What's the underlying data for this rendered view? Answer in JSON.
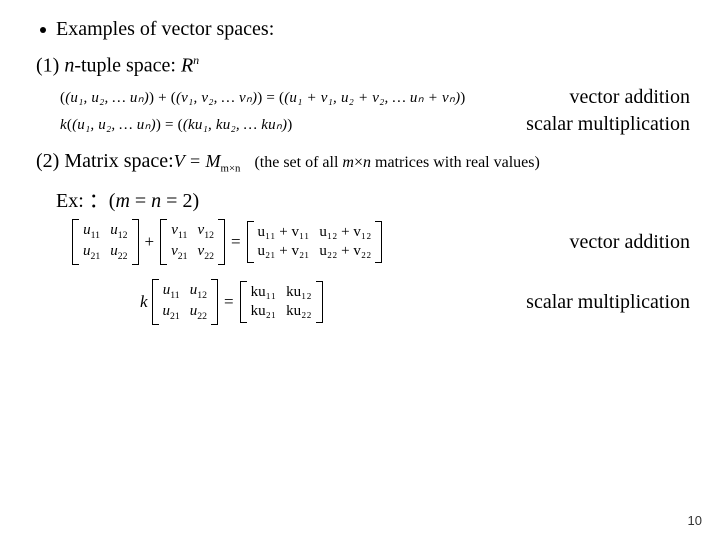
{
  "header": {
    "bullet_title": "Examples of vector spaces:"
  },
  "sec1": {
    "label_prefix": "(1) ",
    "label_n": "n",
    "label_suffix": "-tuple space:  ",
    "space_R": "R",
    "space_exp": "n",
    "eq_add_lhs1": "(u₁, u₂, … uₙ)",
    "eq_add_plus": " + ",
    "eq_add_lhs2": "(v₁, v₂, … vₙ)",
    "eq_add_eq": " = ",
    "eq_add_rhs": "(u₁ + v₁, u₂ + v₂, … uₙ + vₙ)",
    "eq_add_label": "vector addition",
    "eq_sm_k": "k",
    "eq_sm_lhs": "(u₁, u₂, … uₙ)",
    "eq_sm_eq": " = ",
    "eq_sm_rhs": "(ku₁, ku₂, … kuₙ)",
    "eq_sm_label": "scalar multiplication"
  },
  "sec2": {
    "label": "(2) Matrix space:  ",
    "V_eq": "V = M",
    "V_sub": "m×n",
    "note_open": "(the set of all ",
    "note_m": "m",
    "note_x": "×",
    "note_n": "n",
    "note_close": " matrices with real values)",
    "ex_prefix": "Ex:  ：(",
    "ex_m": "m",
    "ex_eq1": " = ",
    "ex_n": "n",
    "ex_eq2": " = 2)",
    "u11": "u",
    "u12": "u",
    "u21": "u",
    "u22": "u",
    "v11": "v",
    "v12": "v",
    "v21": "v",
    "v22": "v",
    "s11": "11",
    "s12": "12",
    "s21": "21",
    "s22": "22",
    "plus": "+",
    "eq": "=",
    "sum11": "u₁₁ + v₁₁",
    "sum12": "u₁₂ + v₁₂",
    "sum21": "u₂₁ + v₂₁",
    "sum22": "u₂₂ + v₂₂",
    "add_label": "vector addition",
    "k": "k",
    "ku11": "ku₁₁",
    "ku12": "ku₁₂",
    "ku21": "ku₂₁",
    "ku22": "ku₂₂",
    "sm_label": "scalar multiplication"
  },
  "page": {
    "num": "10"
  }
}
